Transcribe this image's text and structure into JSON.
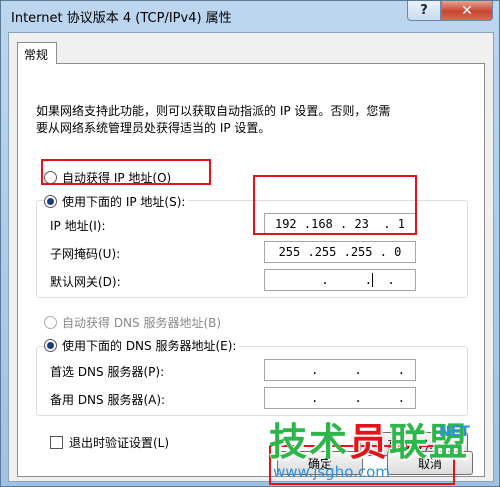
{
  "window": {
    "title": "Internet 协议版本 4 (TCP/IPv4) 属性",
    "help_label": "?",
    "close_label": "✕"
  },
  "tab": {
    "label": "常规"
  },
  "description": [
    "如果网络支持此功能，则可以获取自动指派的 IP 设置。否则，您需",
    "要从网络系统管理员处获得适当的 IP 设置。"
  ],
  "ip_mode": {
    "auto_label": "自动获得 IP 地址(O)",
    "manual_label": "使用下面的 IP 地址(S):",
    "selected": "manual"
  },
  "ip_fields": {
    "ip_label": "IP 地址(I):",
    "ip_value": "192 .168 . 23  . 1",
    "mask_label": "子网掩码(U):",
    "mask_value": "255 .255 .255 . 0",
    "gateway_label": "默认网关(D):",
    "gateway_value": "     .     .",
    "gateway_tail": "  ."
  },
  "dns_mode": {
    "auto_label": "自动获得 DNS 服务器地址(B)",
    "manual_label": "使用下面的 DNS 服务器地址(E):",
    "selected": "manual"
  },
  "dns_fields": {
    "preferred_label": "首选 DNS 服务器(P):",
    "preferred_value": "     .     .     .",
    "alternate_label": "备用 DNS 服务器(A):",
    "alternate_value": "     .     .     ."
  },
  "validate": {
    "label": "退出时验证设置(L)",
    "checked": false
  },
  "buttons": {
    "advanced": "高级(V)...",
    "ok": "确定",
    "cancel": "取消"
  },
  "watermark": {
    "brand_a": "技术",
    "brand_b": "员",
    "brand_c": "联盟",
    "net": "NET",
    "url": "www.jsgho.com"
  },
  "colors": {
    "highlight": "#e2141a",
    "watermark_green": "#2db64a",
    "watermark_blue": "#2e8fd8"
  }
}
